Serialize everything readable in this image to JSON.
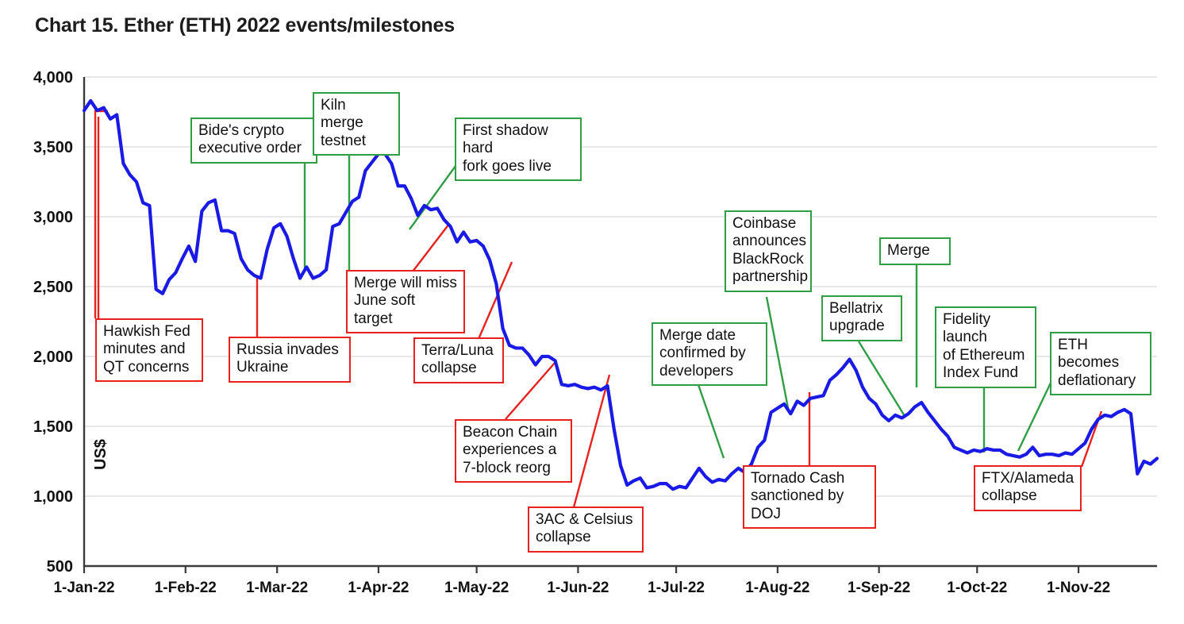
{
  "title": "Chart 15. Ether (ETH) 2022 events/milestones",
  "axes": {
    "y_title": "US$",
    "y_ticks": [
      "4,000",
      "3,500",
      "3,000",
      "2,500",
      "2,000",
      "1,500",
      "1,000",
      "500"
    ],
    "x_ticks": [
      "1-Jan-22",
      "1-Feb-22",
      "1-Mar-22",
      "1-Apr-22",
      "1-May-22",
      "1-Jun-22",
      "1-Jul-22",
      "1-Aug-22",
      "1-Sep-22",
      "1-Oct-22",
      "1-Nov-22"
    ]
  },
  "colors": {
    "series": "#1a1ae6",
    "positive_event": "#2f9e44",
    "negative_event": "#e8211e",
    "grid": "#d9d9d9",
    "axis": "#3a3a3a"
  },
  "annotations": [
    {
      "id": "hawkish-fed",
      "label": "Hawkish Fed\nminutes and\nQT concerns",
      "kind": "negative"
    },
    {
      "id": "bidens-crypto-order",
      "label": "Bide's crypto\nexecutive order",
      "kind": "positive"
    },
    {
      "id": "kiln-merge-testnet",
      "label": "Kiln merge\ntestnet",
      "kind": "positive"
    },
    {
      "id": "russia-invades-ukraine",
      "label": "Russia invades\nUkraine",
      "kind": "negative"
    },
    {
      "id": "first-shadow-hard-fork",
      "label": "First shadow hard\nfork goes live",
      "kind": "positive"
    },
    {
      "id": "merge-miss-june-target",
      "label": "Merge will miss\nJune soft target",
      "kind": "negative"
    },
    {
      "id": "terra-luna-collapse",
      "label": "Terra/Luna\ncollapse",
      "kind": "negative"
    },
    {
      "id": "beacon-chain-reorg",
      "label": "Beacon Chain\nexperiences a\n7-block reorg",
      "kind": "negative"
    },
    {
      "id": "3ac-celsius-collapse",
      "label": "3AC & Celsius\ncollapse",
      "kind": "negative"
    },
    {
      "id": "merge-date-confirmed",
      "label": "Merge date\nconfirmed by\ndevelopers",
      "kind": "positive"
    },
    {
      "id": "coinbase-blackrock",
      "label": "Coinbase\nannounces\nBlackRock\npartnership",
      "kind": "positive"
    },
    {
      "id": "tornado-cash-sanctioned",
      "label": "Tornado Cash\nsanctioned by DOJ",
      "kind": "negative"
    },
    {
      "id": "bellatrix-upgrade",
      "label": "Bellatrix\nupgrade",
      "kind": "positive"
    },
    {
      "id": "merge",
      "label": "Merge",
      "kind": "positive"
    },
    {
      "id": "fidelity-eth-index-fund",
      "label": "Fidelity launch\nof Ethereum\nIndex Fund",
      "kind": "positive"
    },
    {
      "id": "eth-becomes-deflationary",
      "label": "ETH becomes\ndeflationary",
      "kind": "positive"
    },
    {
      "id": "ftx-alameda-collapse",
      "label": "FTX/Alameda\ncollapse",
      "kind": "negative"
    }
  ],
  "chart_data": {
    "type": "line",
    "title": "Chart 15. Ether (ETH) 2022 events/milestones",
    "xlabel": "",
    "ylabel": "US$",
    "ylim": [
      500,
      4000
    ],
    "ytick_values": [
      500,
      1000,
      1500,
      2000,
      2500,
      3000,
      3500,
      4000
    ],
    "grid": true,
    "legend": "none",
    "x_range": [
      "2022-01-01",
      "2022-11-25"
    ],
    "x_tick_labels": [
      "1-Jan-22",
      "1-Feb-22",
      "1-Mar-22",
      "1-Apr-22",
      "1-May-22",
      "1-Jun-22",
      "1-Jul-22",
      "1-Aug-22",
      "1-Sep-22",
      "1-Oct-22",
      "1-Nov-22"
    ],
    "series": [
      {
        "name": "Ether (ETH) price",
        "color": "#1a1ae6",
        "units": "US$",
        "x": [
          "2022-01-01",
          "2022-01-03",
          "2022-01-05",
          "2022-01-07",
          "2022-01-09",
          "2022-01-11",
          "2022-01-13",
          "2022-01-15",
          "2022-01-17",
          "2022-01-19",
          "2022-01-21",
          "2022-01-23",
          "2022-01-25",
          "2022-01-27",
          "2022-01-29",
          "2022-01-31",
          "2022-02-02",
          "2022-02-04",
          "2022-02-06",
          "2022-02-08",
          "2022-02-10",
          "2022-02-12",
          "2022-02-14",
          "2022-02-16",
          "2022-02-18",
          "2022-02-20",
          "2022-02-22",
          "2022-02-24",
          "2022-02-26",
          "2022-02-28",
          "2022-03-02",
          "2022-03-04",
          "2022-03-06",
          "2022-03-08",
          "2022-03-10",
          "2022-03-12",
          "2022-03-14",
          "2022-03-16",
          "2022-03-18",
          "2022-03-20",
          "2022-03-22",
          "2022-03-24",
          "2022-03-26",
          "2022-03-28",
          "2022-03-30",
          "2022-04-01",
          "2022-04-03",
          "2022-04-05",
          "2022-04-07",
          "2022-04-09",
          "2022-04-11",
          "2022-04-13",
          "2022-04-15",
          "2022-04-17",
          "2022-04-19",
          "2022-04-21",
          "2022-04-23",
          "2022-04-25",
          "2022-04-27",
          "2022-04-29",
          "2022-05-01",
          "2022-05-03",
          "2022-05-05",
          "2022-05-07",
          "2022-05-09",
          "2022-05-11",
          "2022-05-13",
          "2022-05-15",
          "2022-05-17",
          "2022-05-19",
          "2022-05-21",
          "2022-05-23",
          "2022-05-25",
          "2022-05-27",
          "2022-05-29",
          "2022-05-31",
          "2022-06-02",
          "2022-06-04",
          "2022-06-06",
          "2022-06-08",
          "2022-06-10",
          "2022-06-12",
          "2022-06-14",
          "2022-06-16",
          "2022-06-18",
          "2022-06-20",
          "2022-06-22",
          "2022-06-24",
          "2022-06-26",
          "2022-06-28",
          "2022-06-30",
          "2022-07-02",
          "2022-07-04",
          "2022-07-06",
          "2022-07-08",
          "2022-07-10",
          "2022-07-12",
          "2022-07-14",
          "2022-07-16",
          "2022-07-18",
          "2022-07-20",
          "2022-07-22",
          "2022-07-24",
          "2022-07-26",
          "2022-07-28",
          "2022-07-30",
          "2022-08-01",
          "2022-08-03",
          "2022-08-05",
          "2022-08-07",
          "2022-08-09",
          "2022-08-11",
          "2022-08-13",
          "2022-08-15",
          "2022-08-17",
          "2022-08-19",
          "2022-08-21",
          "2022-08-23",
          "2022-08-25",
          "2022-08-27",
          "2022-08-29",
          "2022-08-31",
          "2022-09-02",
          "2022-09-04",
          "2022-09-06",
          "2022-09-08",
          "2022-09-10",
          "2022-09-12",
          "2022-09-14",
          "2022-09-16",
          "2022-09-18",
          "2022-09-20",
          "2022-09-22",
          "2022-09-24",
          "2022-09-26",
          "2022-09-28",
          "2022-09-30",
          "2022-10-02",
          "2022-10-04",
          "2022-10-06",
          "2022-10-08",
          "2022-10-10",
          "2022-10-12",
          "2022-10-14",
          "2022-10-16",
          "2022-10-18",
          "2022-10-20",
          "2022-10-22",
          "2022-10-24",
          "2022-10-26",
          "2022-10-28",
          "2022-10-30",
          "2022-11-01",
          "2022-11-03",
          "2022-11-05",
          "2022-11-07",
          "2022-11-09",
          "2022-11-11",
          "2022-11-13",
          "2022-11-15",
          "2022-11-17",
          "2022-11-19",
          "2022-11-21",
          "2022-11-23",
          "2022-11-25"
        ],
        "y": [
          3760,
          3830,
          3760,
          3780,
          3700,
          3730,
          3380,
          3300,
          3250,
          3100,
          3080,
          2480,
          2450,
          2550,
          2600,
          2700,
          2790,
          2680,
          3040,
          3100,
          3120,
          2900,
          2900,
          2880,
          2700,
          2620,
          2580,
          2560,
          2770,
          2920,
          2950,
          2860,
          2700,
          2560,
          2640,
          2560,
          2580,
          2620,
          2930,
          2950,
          3030,
          3110,
          3140,
          3330,
          3390,
          3450,
          3450,
          3380,
          3220,
          3220,
          3130,
          3010,
          3080,
          3050,
          3060,
          2980,
          2930,
          2820,
          2890,
          2820,
          2830,
          2790,
          2690,
          2520,
          2200,
          2080,
          2060,
          2060,
          2010,
          1940,
          2000,
          2000,
          1970,
          1800,
          1790,
          1800,
          1780,
          1770,
          1780,
          1760,
          1790,
          1480,
          1220,
          1080,
          1110,
          1130,
          1060,
          1070,
          1090,
          1090,
          1050,
          1070,
          1060,
          1130,
          1200,
          1140,
          1100,
          1120,
          1110,
          1160,
          1200,
          1170,
          1230,
          1350,
          1400,
          1600,
          1630,
          1660,
          1590,
          1680,
          1650,
          1700,
          1710,
          1720,
          1830,
          1870,
          1920,
          1980,
          1900,
          1780,
          1700,
          1660,
          1580,
          1540,
          1580,
          1560,
          1590,
          1640,
          1670,
          1600,
          1540,
          1480,
          1430,
          1350,
          1330,
          1310,
          1330,
          1320,
          1340,
          1330,
          1330,
          1300,
          1290,
          1280,
          1300,
          1350,
          1290,
          1300,
          1300,
          1290,
          1310,
          1300,
          1340,
          1380,
          1480,
          1550,
          1580,
          1570,
          1600,
          1620,
          1590,
          1160,
          1250,
          1230,
          1270,
          1230,
          1200,
          1190,
          1210,
          1120
        ]
      }
    ],
    "event_annotations": [
      {
        "label": "Hawkish Fed minutes and QT concerns",
        "kind": "negative",
        "date": "2022-01-05",
        "value": 3760
      },
      {
        "label": "Bide's crypto executive order",
        "kind": "positive",
        "date": "2022-03-09",
        "value": 2600
      },
      {
        "label": "Kiln merge testnet",
        "kind": "positive",
        "date": "2022-03-15",
        "value": 2570
      },
      {
        "label": "Russia invades Ukraine",
        "kind": "negative",
        "date": "2022-02-24",
        "value": 2560
      },
      {
        "label": "First shadow hard fork goes live",
        "kind": "positive",
        "date": "2022-04-26",
        "value": 2930
      },
      {
        "label": "Merge will miss June soft target",
        "kind": "negative",
        "date": "2022-04-30",
        "value": 2830
      },
      {
        "label": "Terra/Luna collapse",
        "kind": "negative",
        "date": "2022-05-09",
        "value": 2200
      },
      {
        "label": "Beacon Chain experiences a 7-block reorg",
        "kind": "negative",
        "date": "2022-05-25",
        "value": 1970
      },
      {
        "label": "3AC & Celsius collapse",
        "kind": "negative",
        "date": "2022-06-12",
        "value": 1790
      },
      {
        "label": "Merge date confirmed by developers",
        "kind": "positive",
        "date": "2022-07-14",
        "value": 1120
      },
      {
        "label": "Coinbase announces BlackRock partnership",
        "kind": "positive",
        "date": "2022-08-04",
        "value": 1630
      },
      {
        "label": "Tornado Cash sanctioned by DOJ",
        "kind": "negative",
        "date": "2022-08-08",
        "value": 1700
      },
      {
        "label": "Bellatrix upgrade",
        "kind": "positive",
        "date": "2022-09-06",
        "value": 1580
      },
      {
        "label": "Merge",
        "kind": "positive",
        "date": "2022-09-15",
        "value": 1640
      },
      {
        "label": "Fidelity launch of Ethereum Index Fund",
        "kind": "positive",
        "date": "2022-10-04",
        "value": 1320
      },
      {
        "label": "ETH becomes deflationary",
        "kind": "positive",
        "date": "2022-10-28",
        "value": 1340
      },
      {
        "label": "FTX/Alameda collapse",
        "kind": "negative",
        "date": "2022-11-08",
        "value": 1590
      }
    ]
  }
}
